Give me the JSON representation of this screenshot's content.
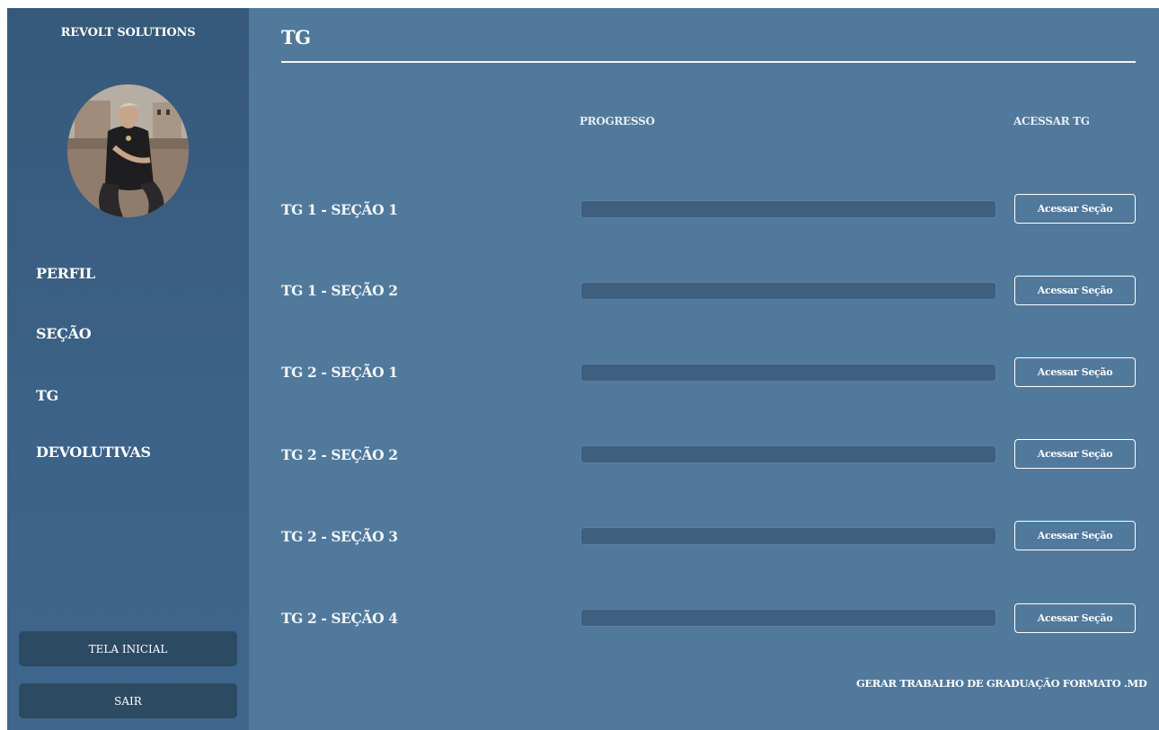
{
  "sidebar": {
    "brand": "REVOLT SOLUTIONS",
    "nav": [
      "PERFIL",
      "SEÇÃO",
      "TG",
      "DEVOLUTIVAS"
    ],
    "home_label": "TELA INICIAL",
    "logout_label": "SAIR"
  },
  "main": {
    "title": "TG",
    "progress_header": "PROGRESSO",
    "access_header": "ACESSAR TG",
    "rows": [
      {
        "label": "TG 1 - SEÇÃO 1",
        "progress": 0,
        "button": "Acessar Seção"
      },
      {
        "label": "TG 1 - SEÇÃO 2",
        "progress": 0,
        "button": "Acessar Seção"
      },
      {
        "label": "TG 2 - SEÇÃO 1",
        "progress": 0,
        "button": "Acessar Seção"
      },
      {
        "label": "TG 2 - SEÇÃO 2",
        "progress": 0,
        "button": "Acessar Seção"
      },
      {
        "label": "TG 2 - SEÇÃO 3",
        "progress": 0,
        "button": "Acessar Seção"
      },
      {
        "label": "TG 2 - SEÇÃO 4",
        "progress": 0,
        "button": "Acessar Seção"
      }
    ],
    "generate_label": "GERAR TRABALHO DE GRADUAÇÃO FORMATO .MD"
  },
  "colors": {
    "sidebar": "#3c6287",
    "main": "#50799c",
    "button_dark": "#2d4a63",
    "bar_track": "#3f5f7e"
  }
}
